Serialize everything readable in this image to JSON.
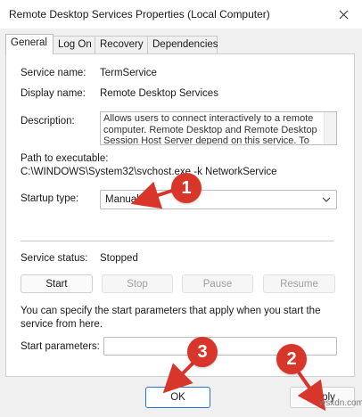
{
  "window": {
    "title": "Remote Desktop Services Properties (Local Computer)"
  },
  "tabs": [
    {
      "label": "General",
      "active": true
    },
    {
      "label": "Log On",
      "active": false
    },
    {
      "label": "Recovery",
      "active": false
    },
    {
      "label": "Dependencies",
      "active": false
    }
  ],
  "general": {
    "service_name_label": "Service name:",
    "service_name": "TermService",
    "display_name_label": "Display name:",
    "display_name": "Remote Desktop Services",
    "description_label": "Description:",
    "description": "Allows users to connect interactively to a remote computer. Remote Desktop and Remote Desktop Session Host Server depend on this service.  To",
    "path_label": "Path to executable:",
    "path": "C:\\WINDOWS\\System32\\svchost.exe -k NetworkService",
    "startup_type_label": "Startup type:",
    "startup_type": "Manual",
    "service_status_label": "Service status:",
    "service_status": "Stopped",
    "hint": "You can specify the start parameters that apply when you start the service from here.",
    "start_params_label": "Start parameters:",
    "start_params_value": ""
  },
  "service_buttons": {
    "start": "Start",
    "stop": "Stop",
    "pause": "Pause",
    "resume": "Resume"
  },
  "dialog_buttons": {
    "ok": "OK",
    "apply": "Apply"
  },
  "callouts": {
    "one": "1",
    "two": "2",
    "three": "3"
  },
  "watermark": "wsxdn.com",
  "colors": {
    "callout": "#d9362b",
    "accent": "#2a6fd0"
  },
  "icons": {
    "close": "close-icon",
    "dropdown": "chevron-down-icon"
  }
}
